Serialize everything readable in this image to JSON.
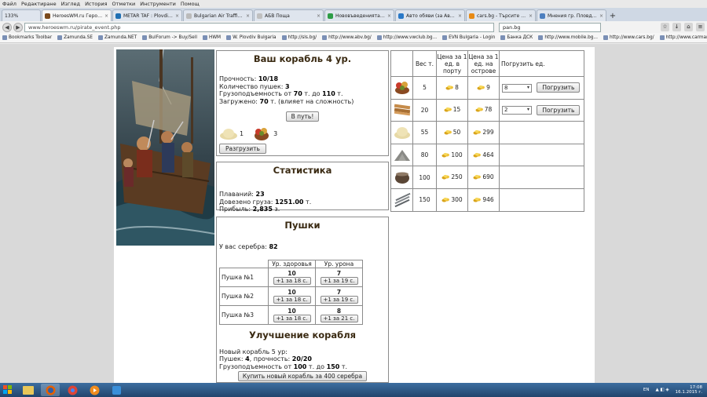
{
  "browser": {
    "menu": [
      "Файл",
      "Редактиране",
      "Изглед",
      "История",
      "Отметки",
      "Инструменти",
      "Помощ"
    ],
    "zoom": "133%",
    "tabs": [
      {
        "label": "HeroesWM.ru Героя войн...",
        "color": "#7a4a1c",
        "active": true
      },
      {
        "label": "METAR TAF : Plovdiv Bulg...",
        "color": "#1f6fb3",
        "active": false
      },
      {
        "label": "Bulgarian Air Traffic Services A...",
        "color": "#bbbbbb",
        "active": false
      },
      {
        "label": "АБВ Поща",
        "color": "#c0c0c0",
        "active": false
      },
      {
        "label": "Нововъведенията във Фо...",
        "color": "#2e9d47",
        "active": false
      },
      {
        "label": "Авто обяви (за Автомоби...",
        "color": "#2a79c8",
        "active": false
      },
      {
        "label": "cars.bg - Търсите Автомо...",
        "color": "#e88a14",
        "active": false
      },
      {
        "label": "Мнения гр. Пловдив - D...",
        "color": "#4d7fbf",
        "active": false
      }
    ],
    "url": "www.heroeswm.ru/pirate_event.php",
    "search": "pan.bg",
    "bookmarks": [
      "Bookmarks Toolbar",
      "Zamunda.SE",
      "Zamunda.NET",
      "BulForum -> Buy/Sell",
      "HWM",
      "W. Plovdiv Bulgaria",
      "http://sls.bg/",
      "http://www.abv.bg/",
      "http://www.vwclub.bg...",
      "EVN Bulgaria - Login",
      "Банка ДСК",
      "http://www.mobile.bg...",
      "http://www.cars.bg/",
      "http://www.carmarket...",
      "http://www.vestnicite..."
    ]
  },
  "ship": {
    "title": "Ваш корабль 4 ур.",
    "durability_label": "Прочность: ",
    "durability": "10/18",
    "cannons_label": "Количество пушек: ",
    "cannons": "3",
    "capacity_label": "Грузоподъемность от ",
    "capacity_from": "70",
    "capacity_mid": " т. до ",
    "capacity_to": "110",
    "capacity_unit": " т.",
    "loaded_label": "Загружено: ",
    "loaded": "70",
    "loaded_note": " т. (влияет на сложность)",
    "sail_button": "В путь!",
    "cargo": [
      {
        "icon": "grain-sack-icon",
        "qty": "1"
      },
      {
        "icon": "fruit-basket-icon",
        "qty": "3"
      }
    ],
    "unload_button": "Разгрузить"
  },
  "stats": {
    "title": "Статистика",
    "voyages_label": "Плаваний: ",
    "voyages": "23",
    "delivered_label": "Довезено груза: ",
    "delivered": "1251.00",
    "delivered_unit": " т.",
    "profit_label": "Прибыль: ",
    "profit": "2,835",
    "profit_unit": " з."
  },
  "market": {
    "headers": [
      "Вес т.",
      "Цена за 1 ед. в порту",
      "Цена за 1 ед. на острове",
      "Погрузить ед."
    ],
    "rows": [
      {
        "icon": "fruit-basket-icon",
        "weight": "5",
        "port_price": "8",
        "island_price": "9",
        "qty": "8",
        "button": "Погрузить"
      },
      {
        "icon": "wood-planks-icon",
        "weight": "20",
        "port_price": "15",
        "island_price": "78",
        "qty": "2",
        "button": "Погрузить"
      },
      {
        "icon": "grain-sack-icon",
        "weight": "55",
        "port_price": "50",
        "island_price": "299",
        "qty": "",
        "button": ""
      },
      {
        "icon": "ore-pile-icon",
        "weight": "80",
        "port_price": "100",
        "island_price": "464",
        "qty": "",
        "button": ""
      },
      {
        "icon": "cauldron-icon",
        "weight": "100",
        "port_price": "250",
        "island_price": "690",
        "qty": "",
        "button": ""
      },
      {
        "icon": "iron-bars-icon",
        "weight": "150",
        "port_price": "300",
        "island_price": "946",
        "qty": "",
        "button": ""
      }
    ]
  },
  "cannons": {
    "title": "Пушки",
    "silver_label": "У вас серебра: ",
    "silver": "82",
    "col_health": "Ур. здоровья",
    "col_damage": "Ур. урона",
    "rows": [
      {
        "name": "Пушка №1",
        "health": "10",
        "health_btn": "+1 за 18 с.",
        "damage": "7",
        "damage_btn": "+1 за 19 с."
      },
      {
        "name": "Пушка №2",
        "health": "10",
        "health_btn": "+1 за 18 с.",
        "damage": "7",
        "damage_btn": "+1 за 19 с."
      },
      {
        "name": "Пушка №3",
        "health": "10",
        "health_btn": "+1 за 18 с.",
        "damage": "8",
        "damage_btn": "+1 за 21 с."
      }
    ]
  },
  "upgrade": {
    "title": "Улучшение корабля",
    "new_ship": "Новый корабль 5 ур:",
    "cannons_label": "Пушек: ",
    "cannons": "4",
    "durability_label": ", прочность: ",
    "durability": "20/20",
    "capacity_label": "Грузоподъемность от ",
    "capacity_from": "100",
    "capacity_mid": " т. до ",
    "capacity_to": "150",
    "capacity_unit": " т.",
    "buy_button": "Купить новый корабль за 400 серебра"
  },
  "taskbar": {
    "lang": "EN",
    "time": "17:08",
    "date": "16.1.2015 г."
  }
}
